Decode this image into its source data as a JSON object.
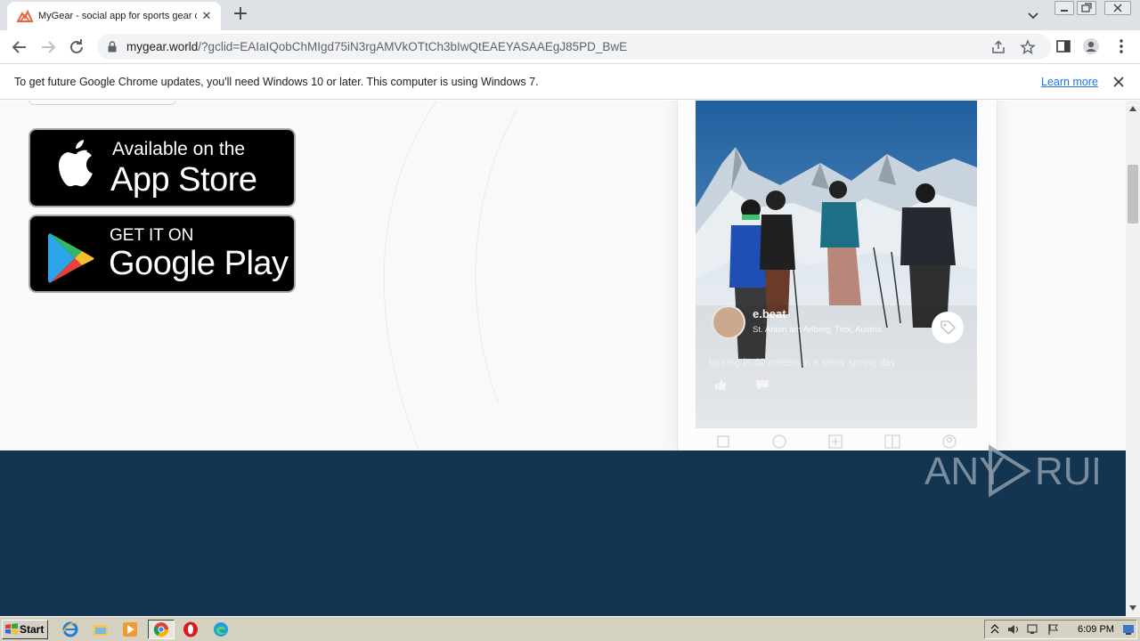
{
  "browser": {
    "tab": {
      "title": "MyGear - social app for sports gear owners",
      "close_glyph": "✕"
    },
    "new_tab_glyph": "+",
    "address": {
      "host": "mygear.world",
      "path": "/?gclid=EAIaIQobChMIgd75iN3rgAMVkOTtCh3bIwQtEAEYASAAEgJ85PD_BwE"
    },
    "icons": [
      "back-icon",
      "forward-icon",
      "reload-icon",
      "lock-icon",
      "share-icon",
      "star-icon",
      "side-panel-icon",
      "profile-icon",
      "menu-icon"
    ],
    "accent_color": "#1a73e8"
  },
  "infobar": {
    "message": "To get future Google Chrome updates, you'll need Windows 10 or later. This computer is using Windows 7.",
    "link": "Learn more"
  },
  "page": {
    "app_store": {
      "line1": "Available on the",
      "line2": "App Store"
    },
    "google_play": {
      "line1": "GET IT ON",
      "line2": "Google Play"
    },
    "post": {
      "user": "e.beat",
      "location": "St. Anton am Arlberg, Tirol, Austria",
      "caption": "touring in 40 meters in a shiny spring day"
    },
    "footer_color": "#133552",
    "watermark": "ANY RUN"
  },
  "taskbar": {
    "start_label": "Start",
    "clock": "6:09 PM",
    "apps": [
      "internet-explorer-icon",
      "file-explorer-icon",
      "media-player-icon",
      "chrome-icon",
      "opera-icon",
      "edge-icon"
    ]
  }
}
